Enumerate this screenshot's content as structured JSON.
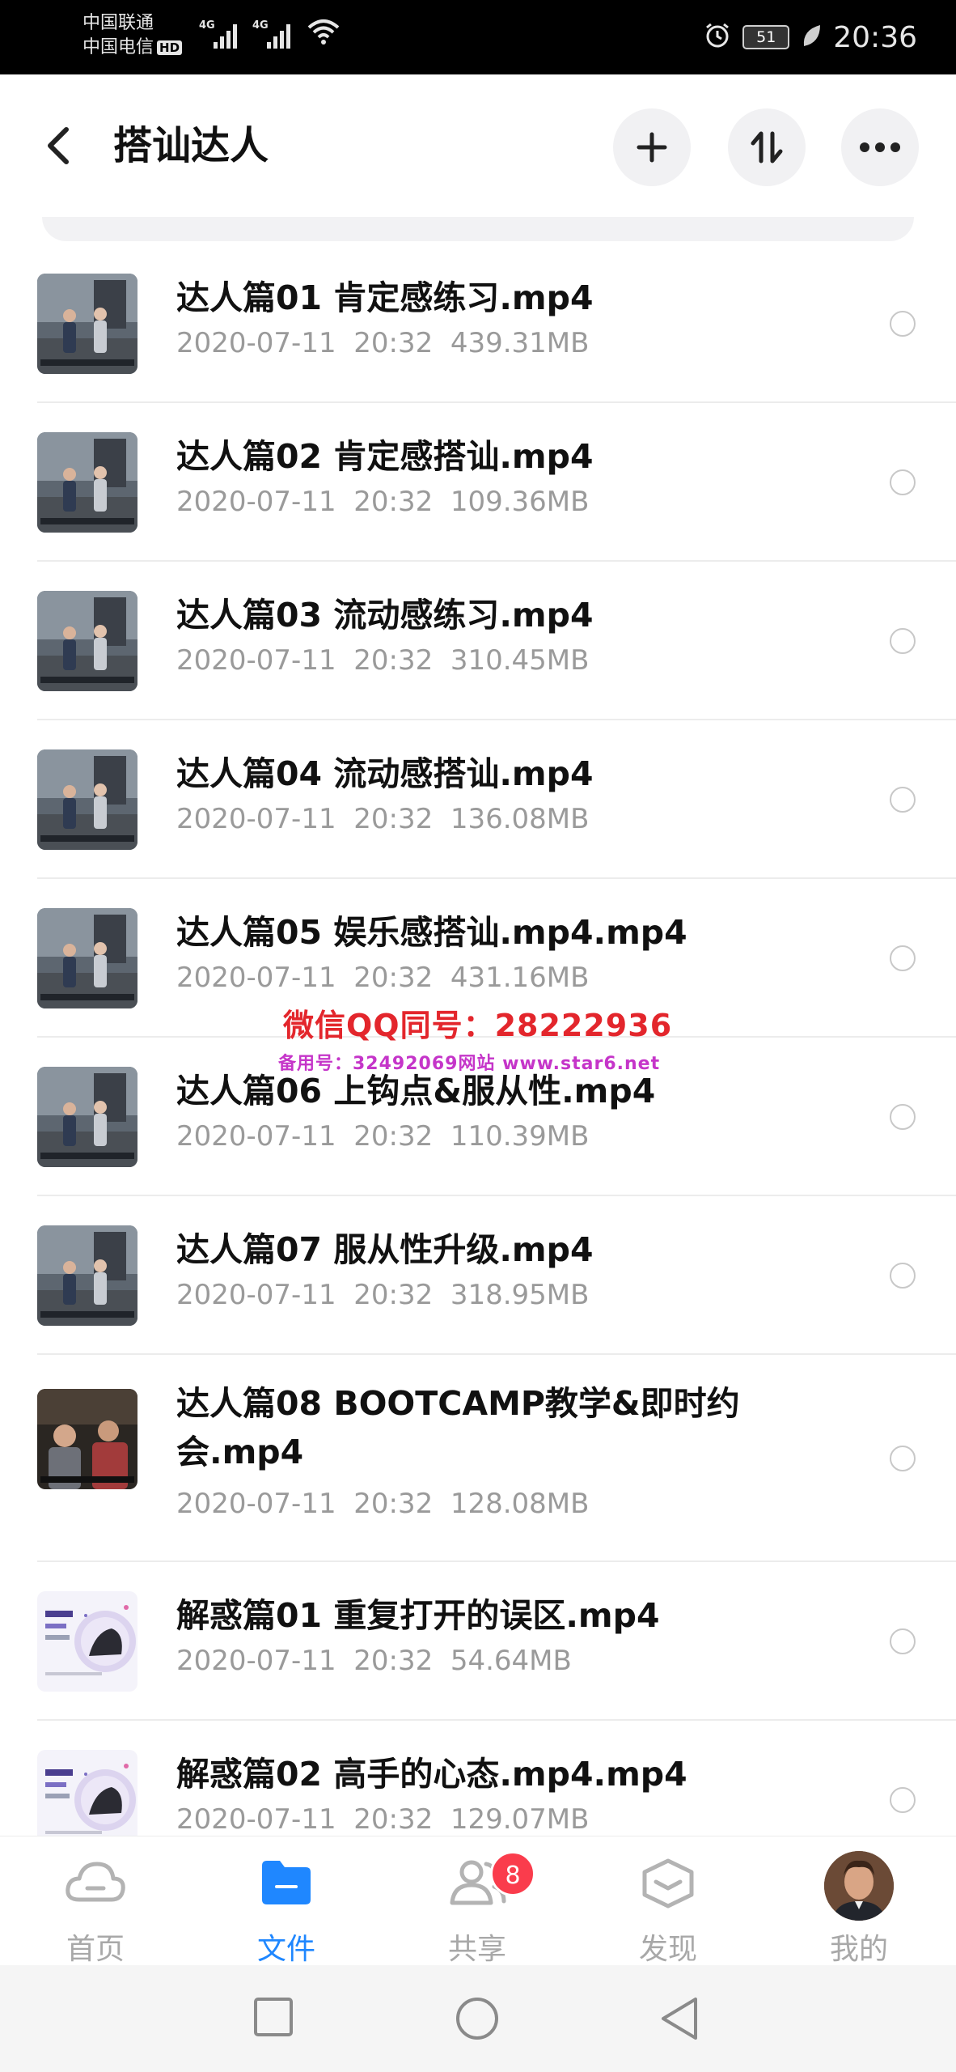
{
  "status_bar": {
    "carrier1": "中国联通",
    "carrier2": "中国电信",
    "hd": "HD",
    "net1": "4G",
    "net2": "4G",
    "battery": "51",
    "time": "20:36"
  },
  "header": {
    "title": "搭讪达人"
  },
  "files": [
    {
      "name": "达人篇01 肯定感练习.mp4",
      "date": "2020-07-11",
      "time": "20:32",
      "size": "439.31MB",
      "thumb": "street"
    },
    {
      "name": "达人篇02 肯定感搭讪.mp4",
      "date": "2020-07-11",
      "time": "20:32",
      "size": "109.36MB",
      "thumb": "street"
    },
    {
      "name": "达人篇03 流动感练习.mp4",
      "date": "2020-07-11",
      "time": "20:32",
      "size": "310.45MB",
      "thumb": "street"
    },
    {
      "name": "达人篇04 流动感搭讪.mp4",
      "date": "2020-07-11",
      "time": "20:32",
      "size": "136.08MB",
      "thumb": "street"
    },
    {
      "name": "达人篇05 娱乐感搭讪.mp4.mp4",
      "date": "2020-07-11",
      "time": "20:32",
      "size": "431.16MB",
      "thumb": "street"
    },
    {
      "name": "达人篇06 上钩点&服从性.mp4",
      "date": "2020-07-11",
      "time": "20:32",
      "size": "110.39MB",
      "thumb": "street"
    },
    {
      "name": "达人篇07 服从性升级.mp4",
      "date": "2020-07-11",
      "time": "20:32",
      "size": "318.95MB",
      "thumb": "street"
    },
    {
      "name": "达人篇08 BOOTCAMP教学&即时约会.mp4",
      "date": "2020-07-11",
      "time": "20:32",
      "size": "128.08MB",
      "thumb": "indoor"
    },
    {
      "name": "解惑篇01 重复打开的误区.mp4",
      "date": "2020-07-11",
      "time": "20:32",
      "size": "54.64MB",
      "thumb": "promo"
    },
    {
      "name": "解惑篇02 高手的心态.mp4.mp4",
      "date": "2020-07-11",
      "time": "20:32",
      "size": "129.07MB",
      "thumb": "promo"
    }
  ],
  "watermark": {
    "line1": "微信QQ同号：28222936",
    "line2": "备用号：32492069网站 www.star6.net"
  },
  "tabs": [
    {
      "label": "首页",
      "icon": "cloud-icon",
      "active": false
    },
    {
      "label": "文件",
      "icon": "folder-icon",
      "active": true
    },
    {
      "label": "共享",
      "icon": "share-people-icon",
      "active": false,
      "badge": "8"
    },
    {
      "label": "发现",
      "icon": "discover-box-icon",
      "active": false
    },
    {
      "label": "我的",
      "icon": "avatar",
      "active": false
    }
  ],
  "colors": {
    "accent": "#1f87ff",
    "badge": "#fa3c4c",
    "meta": "#9a9a9a"
  }
}
